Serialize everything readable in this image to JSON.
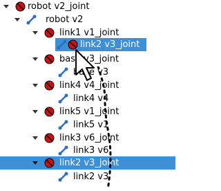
{
  "tree": {
    "rows": [
      {
        "label": "robot v2_joint",
        "type": "joint",
        "expanded": true
      },
      {
        "label": "robot v2",
        "type": "link",
        "expanded": true
      },
      {
        "label": "link1 v1_joint",
        "type": "joint",
        "expanded": true
      },
      {
        "label": "link2 v3_joint",
        "type": "joint",
        "expanded": false,
        "selected": true
      },
      {
        "label": "base v3_joint",
        "type": "joint",
        "expanded": true
      },
      {
        "label": "base v3",
        "type": "link"
      },
      {
        "label": "link4 v4_joint",
        "type": "joint",
        "expanded": true
      },
      {
        "label": "link4 v4",
        "type": "link"
      },
      {
        "label": "link5 v1_joint",
        "type": "joint",
        "expanded": true
      },
      {
        "label": "link5 v1",
        "type": "link"
      },
      {
        "label": "link3 v6_joint",
        "type": "joint",
        "expanded": true
      },
      {
        "label": "link3 v6",
        "type": "link"
      },
      {
        "label": "link2 v3_joint",
        "type": "joint",
        "expanded": true,
        "selected": true
      },
      {
        "label": "link2 v3",
        "type": "link"
      }
    ]
  },
  "colors": {
    "selection": "#3d8fd6",
    "joint_icon": "#cc1111",
    "link_icon": "#2a6fc4"
  }
}
